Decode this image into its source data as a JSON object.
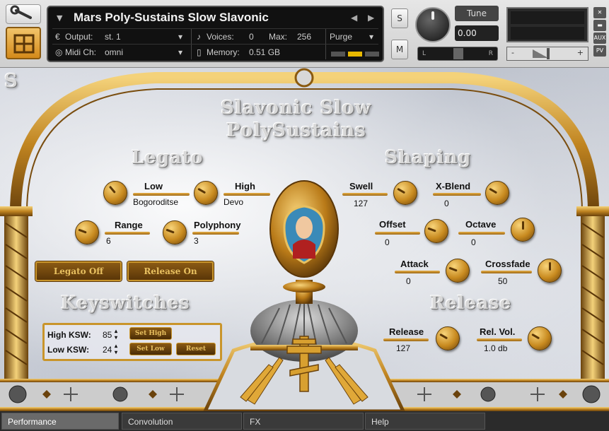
{
  "header": {
    "instrument_title": "Mars Poly-Sustains Slow Slavonic",
    "output_label": "Output:",
    "output_value": "st. 1",
    "voices_label": "Voices:",
    "voices_value": "0",
    "max_label": "Max:",
    "max_value": "256",
    "purge_label": "Purge",
    "midi_label": "Midi Ch:",
    "midi_value": "omni",
    "memory_label": "Memory:",
    "memory_value": "0.51 GB",
    "solo_label": "S",
    "mute_label": "M",
    "tune_label": "Tune",
    "tune_value": "0.00",
    "pan_left": "L",
    "pan_right": "R",
    "vol_minus": "-",
    "vol_plus": "+",
    "aux_label": "AUX",
    "pv_label": "PV"
  },
  "panel": {
    "corner_letter": "S",
    "title_line1": "Slavonic Slow",
    "title_line2": "PolySustains",
    "legato_heading": "Legato",
    "shaping_heading": "Shaping",
    "keyswitches_heading": "Keyswitches",
    "release_heading": "Release"
  },
  "legato": {
    "low_label": "Low",
    "low_value": "Bogoroditse",
    "high_label": "High",
    "high_value": "Devo",
    "range_label": "Range",
    "range_value": "6",
    "polyphony_label": "Polyphony",
    "polyphony_value": "3",
    "legato_button": "Legato Off",
    "release_button": "Release On"
  },
  "shaping": {
    "swell_label": "Swell",
    "swell_value": "127",
    "xblend_label": "X-Blend",
    "xblend_value": "0",
    "offset_label": "Offset",
    "offset_value": "0",
    "octave_label": "Octave",
    "octave_value": "0",
    "attack_label": "Attack",
    "attack_value": "0",
    "crossfade_label": "Crossfade",
    "crossfade_value": "50"
  },
  "release": {
    "release_label": "Release",
    "release_value": "127",
    "relvol_label": "Rel. Vol.",
    "relvol_value": "1.0 db"
  },
  "keyswitches": {
    "high_label": "High KSW:",
    "high_value": "85",
    "low_label": "Low KSW:",
    "low_value": "24",
    "set_high": "Set High",
    "set_low": "Set Low",
    "reset": "Reset"
  },
  "tabs": [
    "Performance",
    "Convolution",
    "FX",
    "Help"
  ],
  "colors": {
    "gold": "#c9952b",
    "dark_bronze": "#5a3608",
    "panel_bg": "#111111"
  }
}
